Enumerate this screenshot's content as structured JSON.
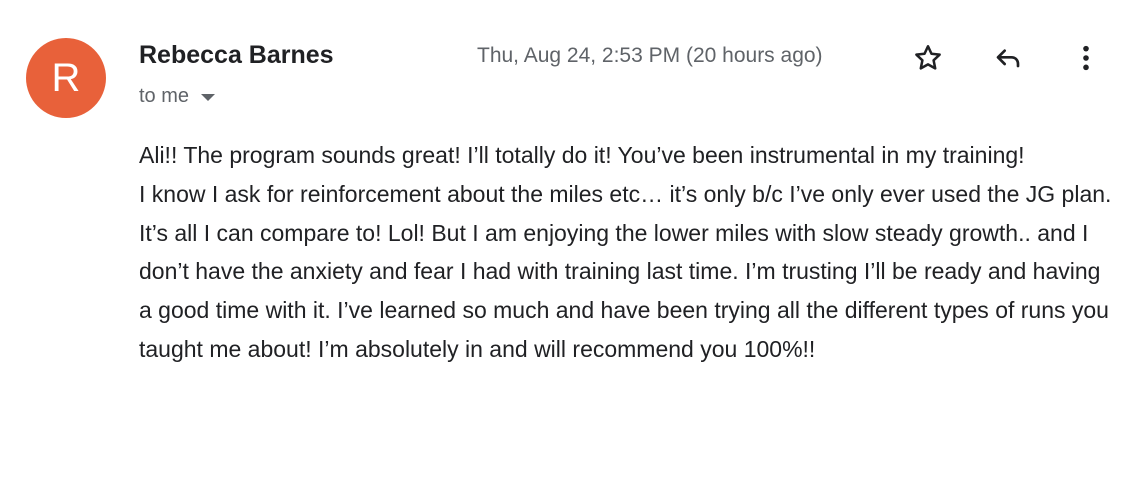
{
  "sender": {
    "avatar_letter": "R",
    "avatar_color": "#e8613a",
    "name": "Rebecca Barnes"
  },
  "recipient": {
    "label": "to me"
  },
  "timestamp": "Thu, Aug 24, 2:53 PM (20 hours ago)",
  "actions": {
    "star_icon": "star-icon",
    "reply_icon": "reply-icon",
    "more_icon": "more-vert-icon"
  },
  "message": {
    "paragraphs": [
      "Ali!! The program sounds great! I’ll totally do it!  You’ve been instrumental in my training!",
      "I know I ask for reinforcement about the miles etc… it’s only b/c I’ve only ever used the JG plan.",
      "It’s all I can compare to! Lol!  But I am enjoying the lower miles with slow steady growth.. and I don’t have the anxiety and fear I had with training last time.  I’m trusting I’ll be ready and having a good time with it.  I’ve learned so much and have been trying all the different types of runs you taught me about! I’m absolutely in and will recommend you 100%!!"
    ]
  }
}
